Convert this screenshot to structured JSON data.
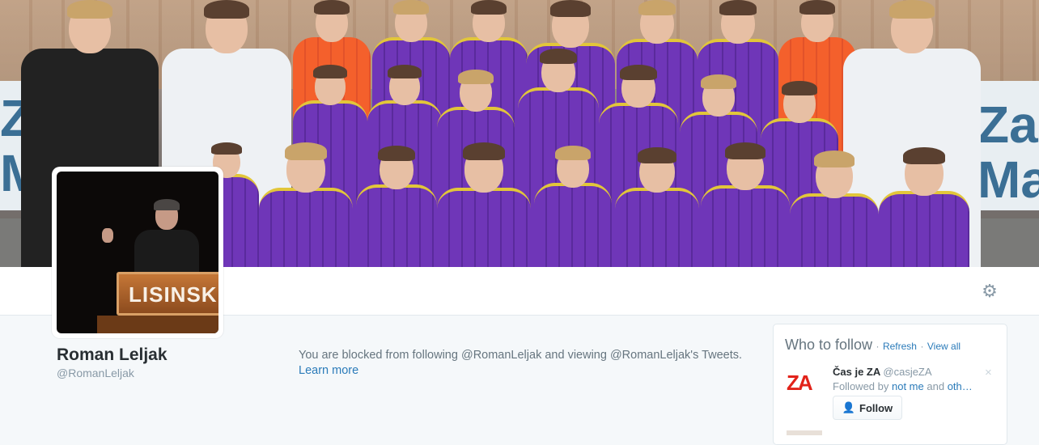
{
  "header": {
    "banner_left_text": "Za\nMa",
    "banner_right_text": "Za\nMa"
  },
  "profile": {
    "name": "Roman Leljak",
    "handle": "@RomanLeljak",
    "avatar_sign_text": "LISINSKI",
    "settings_icon": "gear-icon"
  },
  "blocked": {
    "message": "You are blocked from following @RomanLeljak and viewing @RomanLeljak's Tweets.",
    "learn_more": "Learn more"
  },
  "who_to_follow": {
    "title": "Who to follow",
    "separator": "·",
    "refresh_label": "Refresh",
    "view_all_label": "View all",
    "suggestions": [
      {
        "avatar_text": "ZA",
        "name": "Čas je ZA",
        "handle": "@casjeZA",
        "followed_prefix": "Followed by",
        "followed_user": "not me",
        "followed_and": "and",
        "followed_others": "oth…",
        "follow_label": "Follow",
        "dismiss_icon": "close-icon",
        "dismiss_glyph": "×"
      }
    ]
  },
  "colors": {
    "accent": "#2b7bb9",
    "jersey_purple": "#6f36b8",
    "brand_red": "#e2231a"
  }
}
